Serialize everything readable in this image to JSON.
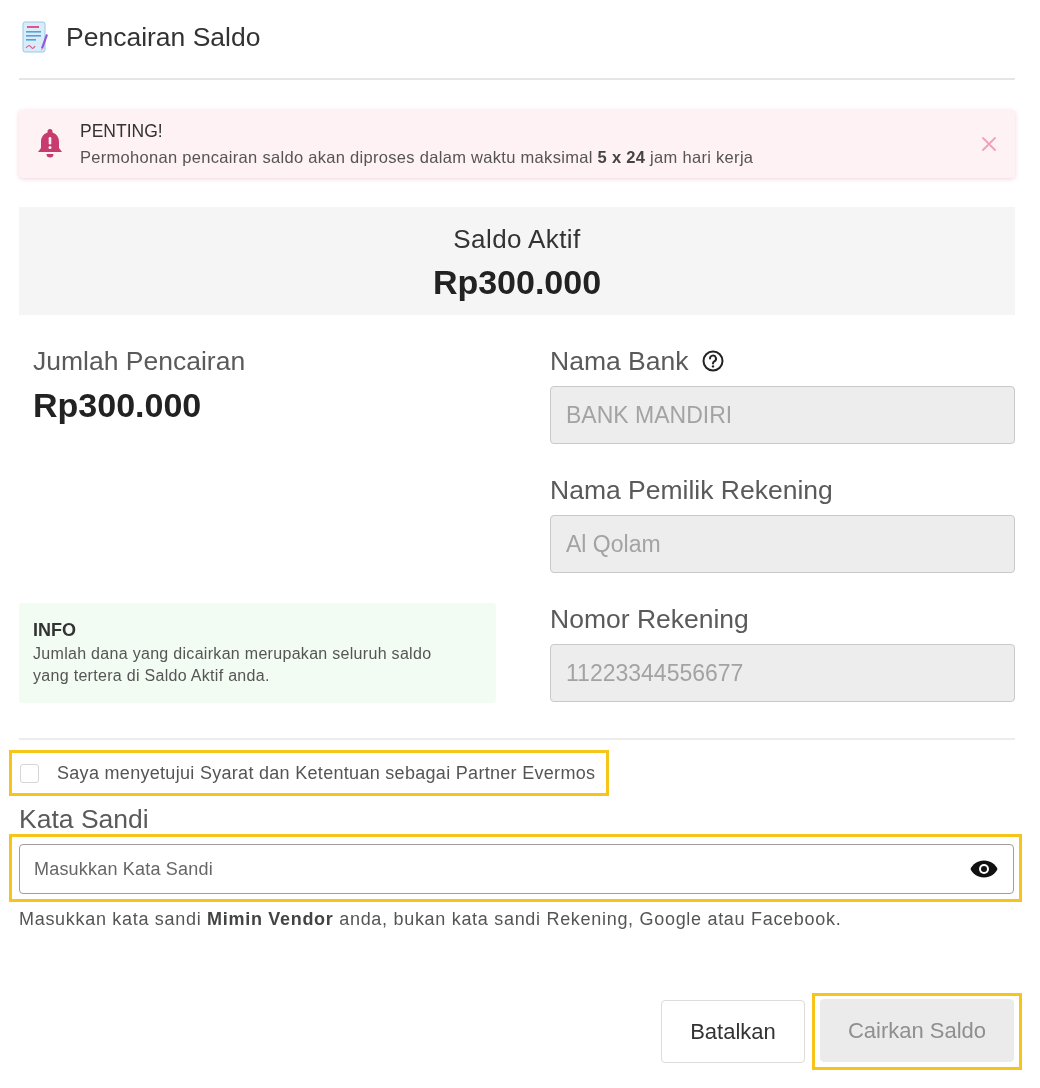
{
  "header": {
    "title": "Pencairan Saldo"
  },
  "alert": {
    "title": "PENTING!",
    "message": "Permohonan pencairan saldo akan diproses dalam waktu maksimal **5 x 24** jam hari kerja"
  },
  "balance": {
    "label": "Saldo Aktif",
    "amount": "Rp300.000"
  },
  "withdrawal": {
    "label": "Jumlah Pencairan",
    "amount": "Rp300.000"
  },
  "info": {
    "title": "INFO",
    "message": "Jumlah dana yang dicairkan merupakan seluruh saldo yang tertera di Saldo Aktif anda."
  },
  "fields": [
    {
      "label": "Nama Bank",
      "value": "BANK MANDIRI",
      "help": true,
      "disabled": true
    },
    {
      "label": "Nama Pemilik Rekening",
      "value": "Al Qolam",
      "help": false,
      "disabled": true
    },
    {
      "label": "Nomor Rekening",
      "value": "11223344556677",
      "help": false,
      "disabled": true
    }
  ],
  "agreement": {
    "label": "Saya menyetujui Syarat dan Ketentuan sebagai Partner Evermos",
    "checked": false,
    "highlighted": true
  },
  "password": {
    "label": "Kata Sandi",
    "placeholder": "Masukkan Kata Sandi",
    "highlighted": true,
    "hint": "Masukkan kata sandi **Mimin Vendor** anda, bukan kata sandi Rekening, Google atau Facebook."
  },
  "buttons": [
    {
      "label": "Batalkan",
      "kind": "secondary",
      "disabled": false,
      "highlighted": false
    },
    {
      "label": "Cairkan Saldo",
      "kind": "primary",
      "disabled": true,
      "highlighted": true
    }
  ]
}
